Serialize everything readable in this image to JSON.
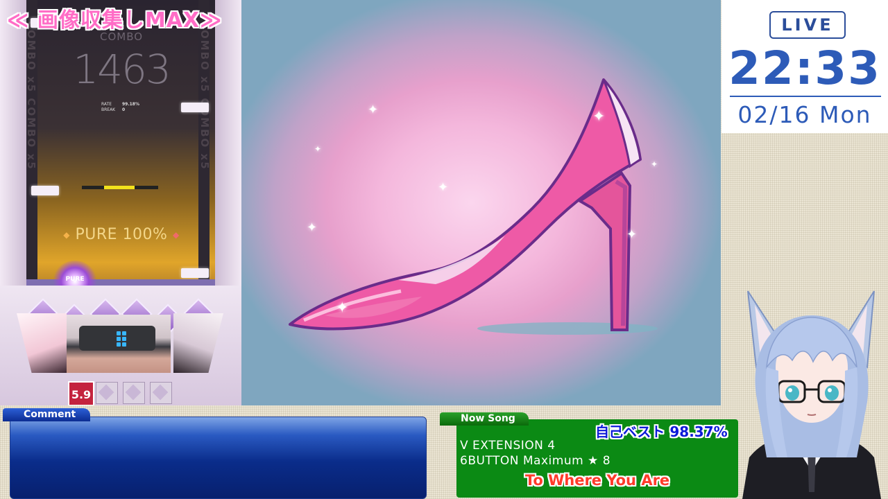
{
  "stream": {
    "title": "≪ 画像収集しMAX≫"
  },
  "game": {
    "combo_label": "COMBO",
    "combo_value": "1463",
    "side_text": "COMBO x5 COMBO x5",
    "rate_label": "RATE",
    "rate_value": "99.18%",
    "break_label": "BREAK",
    "break_value": "0",
    "judgement": "PURE 100%",
    "judge_effect": "PURE",
    "level": "5.9",
    "colors": {
      "lane_glow": "#e0a52a",
      "gauge": "#f2e21c",
      "level_badge": "#c4233e"
    }
  },
  "clock": {
    "live_label": "LIVE",
    "time": "22:33",
    "date": "02/16 Mon"
  },
  "comment": {
    "tab_label": "Comment"
  },
  "now_song": {
    "tab_label": "Now Song",
    "personal_best": "自己ベスト 98.37%",
    "line1": "V EXTENSION 4",
    "line2": "6BUTTON Maximum ★ 8",
    "song_title": "To Where You Are"
  },
  "video": {
    "subject": "pink-high-heel-shoe-illustration"
  }
}
